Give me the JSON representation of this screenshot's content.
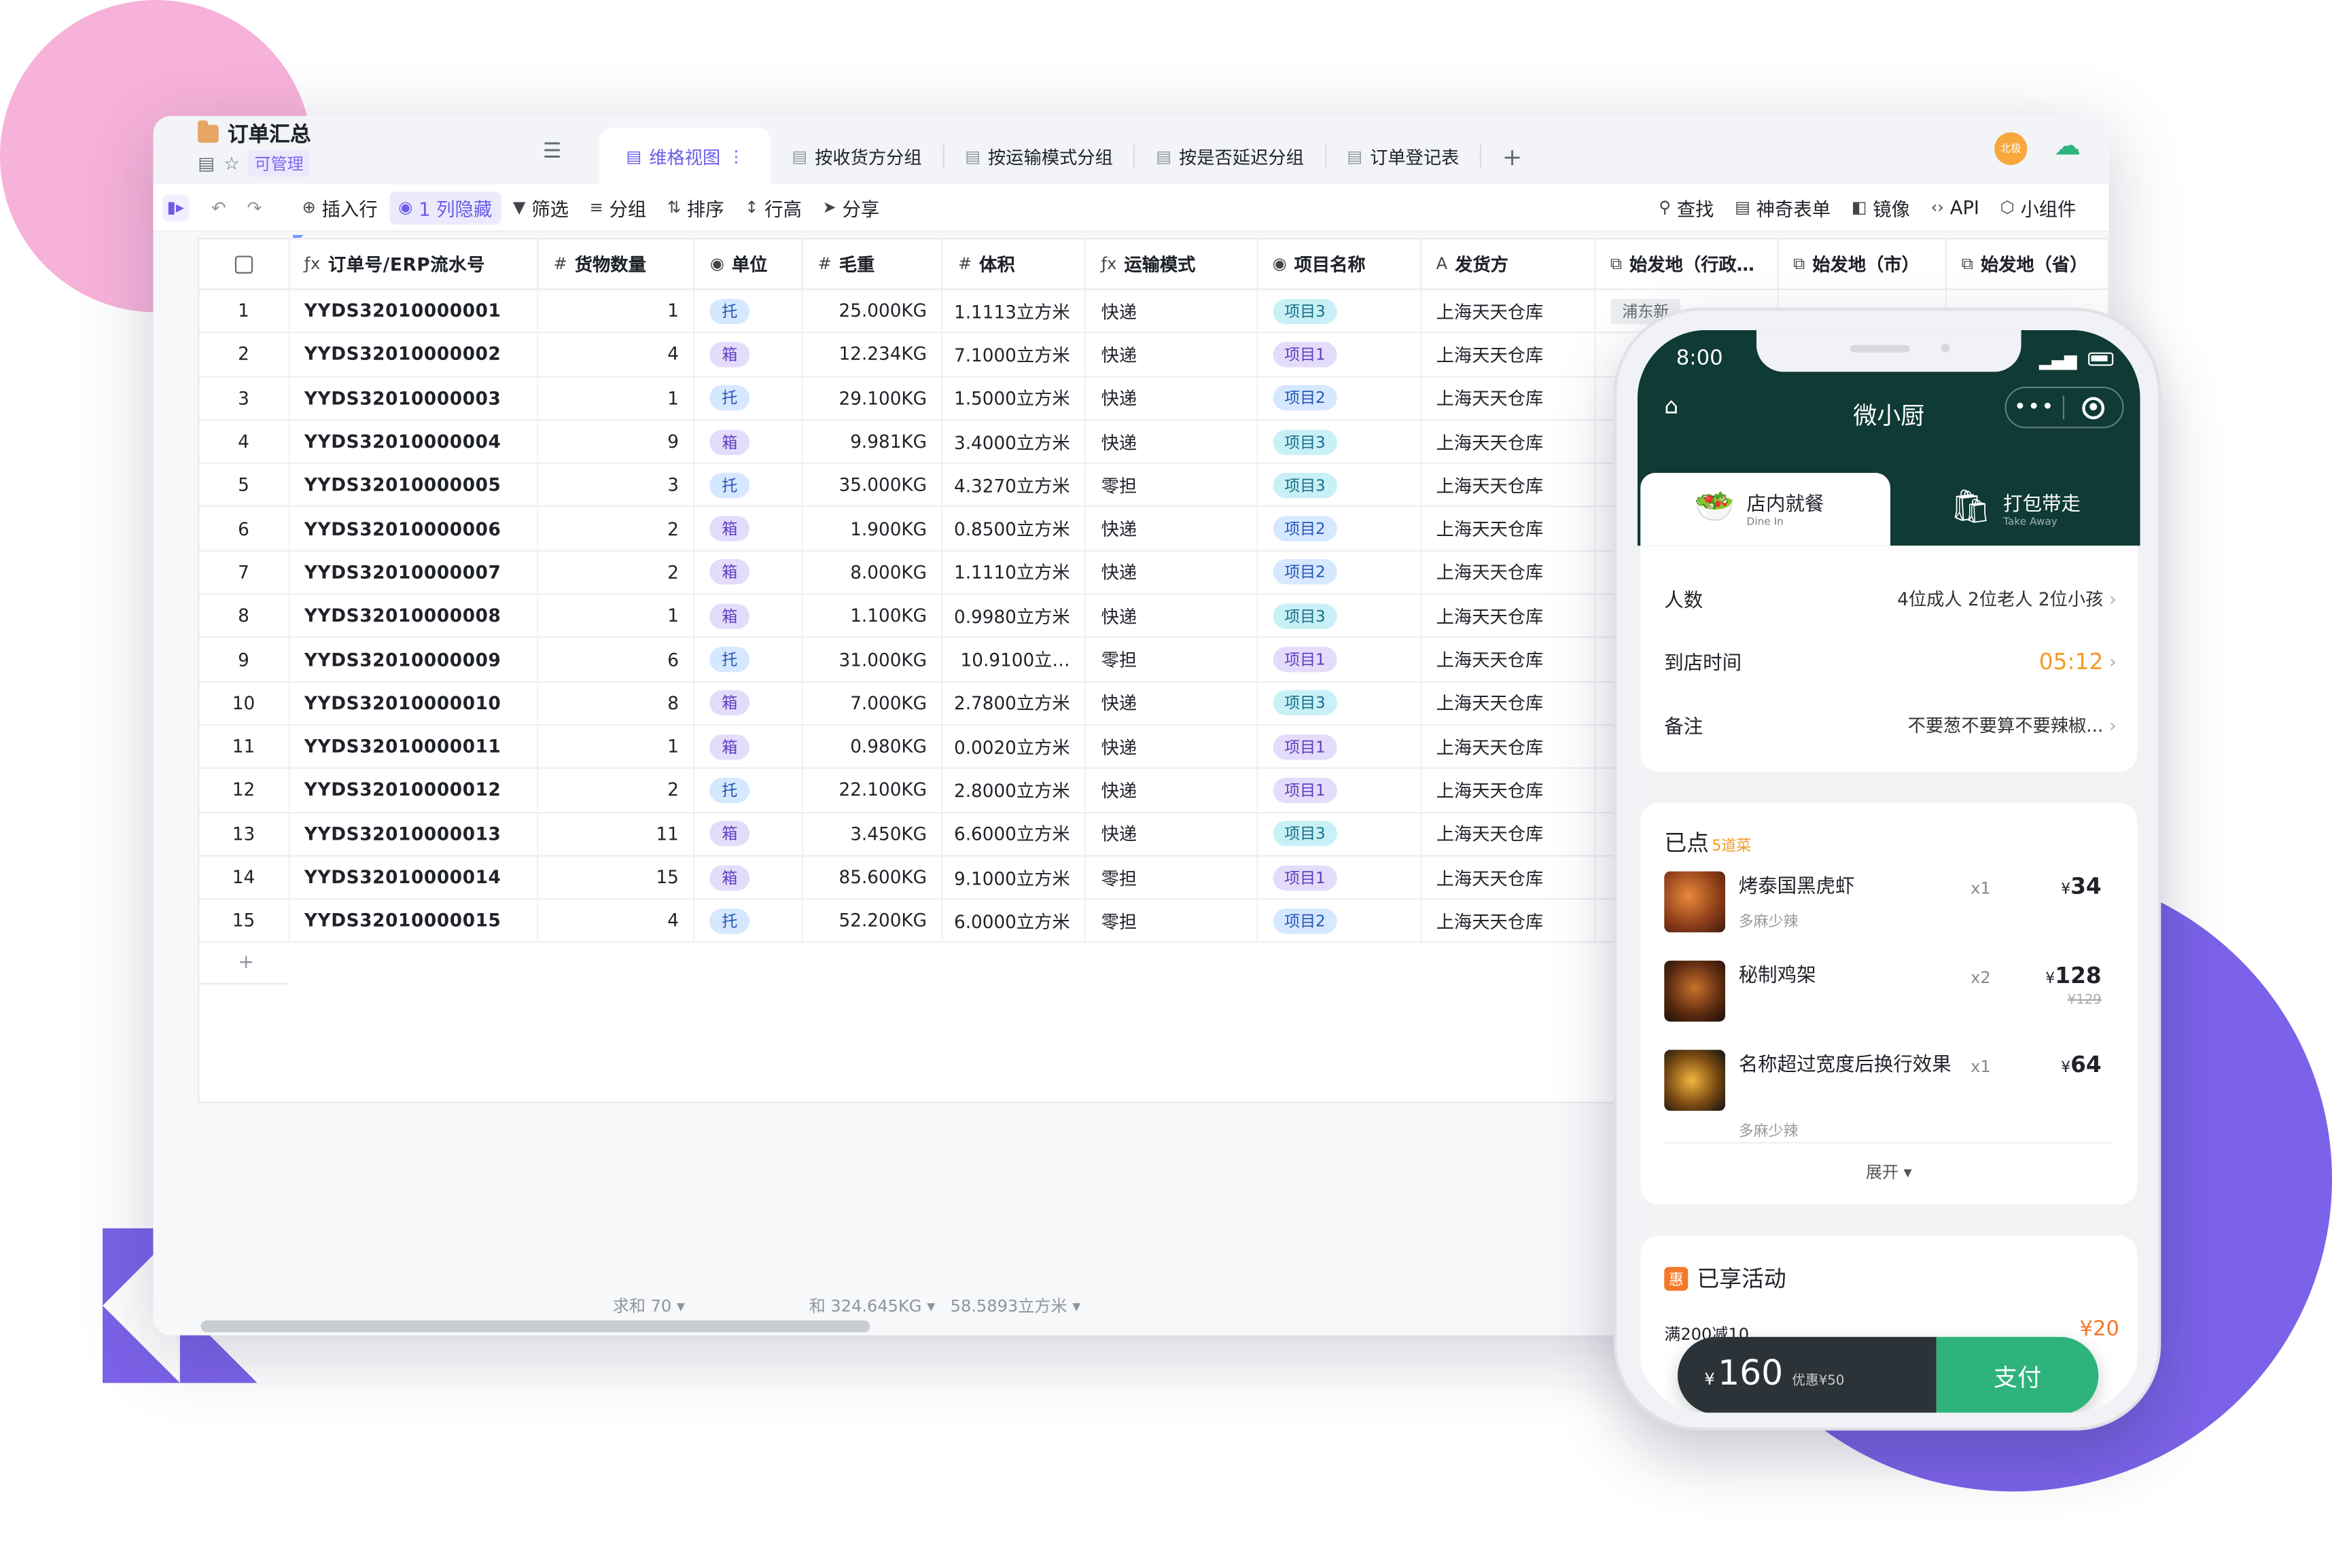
{
  "doc": {
    "title": "订单汇总",
    "permission": "可管理"
  },
  "tabs": [
    {
      "label": "维格视图",
      "active": true
    },
    {
      "label": "按收货方分组"
    },
    {
      "label": "按运输模式分组"
    },
    {
      "label": "按是否延迟分组"
    },
    {
      "label": "订单登记表"
    }
  ],
  "user_badge": "北极",
  "toolbar": {
    "insert_row": "插入行",
    "hidden_cols": "1 列隐藏",
    "filter": "筛选",
    "group": "分组",
    "sort": "排序",
    "row_height": "行高",
    "share": "分享",
    "find": "查找",
    "form": "神奇表单",
    "mirror": "镜像",
    "api": "API",
    "widget": "小组件"
  },
  "columns": [
    "订单号/ERP流水号",
    "货物数量",
    "单位",
    "毛重",
    "体积",
    "运输模式",
    "项目名称",
    "发货方",
    "始发地（行政…",
    "始发地（市）",
    "始发地（省）"
  ],
  "column_icons": [
    "formula-icon",
    "number-icon",
    "select-icon",
    "number-icon",
    "number-icon",
    "formula-icon",
    "select-icon",
    "text-icon",
    "lookup-icon",
    "lookup-icon",
    "lookup-icon"
  ],
  "rows": [
    {
      "idx": "1",
      "order": "YYDS32010000001",
      "qty": "1",
      "unit": "托",
      "weight": "25.000KG",
      "volume": "1.1113立方米",
      "mode": "快递",
      "project": "项目3",
      "shipper": "上海天天仓库",
      "origin": "浦东新"
    },
    {
      "idx": "2",
      "order": "YYDS32010000002",
      "qty": "4",
      "unit": "箱",
      "weight": "12.234KG",
      "volume": "7.1000立方米",
      "mode": "快递",
      "project": "项目1",
      "shipper": "上海天天仓库"
    },
    {
      "idx": "3",
      "order": "YYDS32010000003",
      "qty": "1",
      "unit": "托",
      "weight": "29.100KG",
      "volume": "1.5000立方米",
      "mode": "快递",
      "project": "项目2",
      "shipper": "上海天天仓库"
    },
    {
      "idx": "4",
      "order": "YYDS32010000004",
      "qty": "9",
      "unit": "箱",
      "weight": "9.981KG",
      "volume": "3.4000立方米",
      "mode": "快递",
      "project": "项目3",
      "shipper": "上海天天仓库"
    },
    {
      "idx": "5",
      "order": "YYDS32010000005",
      "qty": "3",
      "unit": "托",
      "weight": "35.000KG",
      "volume": "4.3270立方米",
      "mode": "零担",
      "project": "项目3",
      "shipper": "上海天天仓库"
    },
    {
      "idx": "6",
      "order": "YYDS32010000006",
      "qty": "2",
      "unit": "箱",
      "weight": "1.900KG",
      "volume": "0.8500立方米",
      "mode": "快递",
      "project": "项目2",
      "shipper": "上海天天仓库"
    },
    {
      "idx": "7",
      "order": "YYDS32010000007",
      "qty": "2",
      "unit": "箱",
      "weight": "8.000KG",
      "volume": "1.1110立方米",
      "mode": "快递",
      "project": "项目2",
      "shipper": "上海天天仓库"
    },
    {
      "idx": "8",
      "order": "YYDS32010000008",
      "qty": "1",
      "unit": "箱",
      "weight": "1.100KG",
      "volume": "0.9980立方米",
      "mode": "快递",
      "project": "项目3",
      "shipper": "上海天天仓库"
    },
    {
      "idx": "9",
      "order": "YYDS32010000009",
      "qty": "6",
      "unit": "托",
      "weight": "31.000KG",
      "volume": "10.9100立…",
      "mode": "零担",
      "project": "项目1",
      "shipper": "上海天天仓库"
    },
    {
      "idx": "10",
      "order": "YYDS32010000010",
      "qty": "8",
      "unit": "箱",
      "weight": "7.000KG",
      "volume": "2.7800立方米",
      "mode": "快递",
      "project": "项目3",
      "shipper": "上海天天仓库"
    },
    {
      "idx": "11",
      "order": "YYDS32010000011",
      "qty": "1",
      "unit": "箱",
      "weight": "0.980KG",
      "volume": "0.0020立方米",
      "mode": "快递",
      "project": "项目1",
      "shipper": "上海天天仓库"
    },
    {
      "idx": "12",
      "order": "YYDS32010000012",
      "qty": "2",
      "unit": "托",
      "weight": "22.100KG",
      "volume": "2.8000立方米",
      "mode": "快递",
      "project": "项目1",
      "shipper": "上海天天仓库"
    },
    {
      "idx": "13",
      "order": "YYDS32010000013",
      "qty": "11",
      "unit": "箱",
      "weight": "3.450KG",
      "volume": "6.6000立方米",
      "mode": "快递",
      "project": "项目3",
      "shipper": "上海天天仓库"
    },
    {
      "idx": "14",
      "order": "YYDS32010000014",
      "qty": "15",
      "unit": "箱",
      "weight": "85.600KG",
      "volume": "9.1000立方米",
      "mode": "零担",
      "project": "项目1",
      "shipper": "上海天天仓库"
    },
    {
      "idx": "15",
      "order": "YYDS32010000015",
      "qty": "4",
      "unit": "托",
      "weight": "52.200KG",
      "volume": "6.0000立方米",
      "mode": "零担",
      "project": "项目2",
      "shipper": "上海天天仓库"
    }
  ],
  "footer": {
    "qty_sum": "求和 70",
    "weight_sum": "和 324.645KG",
    "volume_sum": "58.5893立方米"
  },
  "phone": {
    "time": "8:00",
    "title": "微小厨",
    "tab_dine": {
      "label": "店内就餐",
      "sub": "Dine In"
    },
    "tab_take": {
      "label": "打包带走",
      "sub": "Take Away"
    },
    "people_label": "人数",
    "people_value": "4位成人  2位老人  2位小孩",
    "arrive_label": "到店时间",
    "arrive_value": "05:12",
    "note_label": "备注",
    "note_value": "不要葱不要算不要辣椒...",
    "ordered_title": "已点",
    "ordered_count": "5道菜",
    "dishes": [
      {
        "name": "烤泰国黑虎虾",
        "note": "多麻少辣",
        "qty": "x1",
        "price": "34"
      },
      {
        "name": "秘制鸡架",
        "note": "",
        "qty": "x2",
        "price": "128",
        "orig": "¥129"
      },
      {
        "name": "名称超过宽度后换行效果",
        "note": "多麻少辣",
        "qty": "x1",
        "price": "64"
      }
    ],
    "currency": "¥",
    "expand": "展开",
    "promo_title": "已享活动",
    "promo_badge": "惠",
    "promo_line": "满200减10",
    "promo_amount": "¥20",
    "pay_total": "160",
    "pay_discount": "优惠¥50",
    "pay_button": "支付"
  }
}
